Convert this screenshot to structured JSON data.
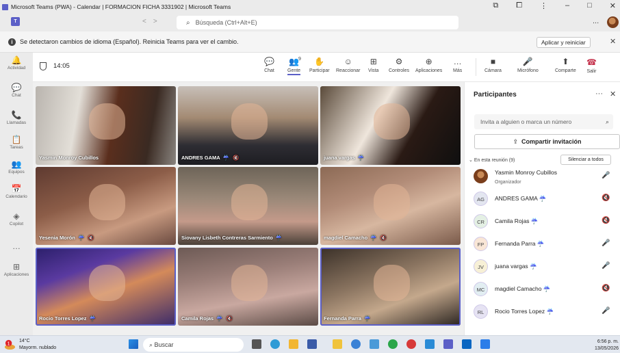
{
  "titlebar": {
    "title": "Microsoft Teams (PWA) - Calendar | FORMACION FICHA 3331902 | Microsoft Teams"
  },
  "searchbar": {
    "placeholder": "Búsqueda (Ctrl+Alt+E)",
    "nav_back": "<",
    "nav_fwd": ">",
    "more": "..."
  },
  "notice": {
    "text": "Se detectaron cambios de idioma (Español). Reinicia Teams para ver el cambio.",
    "restart_button": "Aplicar y reiniciar",
    "close": "✕"
  },
  "rail": [
    {
      "name": "activity",
      "label": "Actividad",
      "icon": "bell-icon",
      "glyph": "🔔"
    },
    {
      "name": "chat",
      "label": "Chat",
      "icon": "chat-icon",
      "glyph": "💬"
    },
    {
      "name": "calls",
      "label": "Llamadas",
      "icon": "phone-icon",
      "glyph": "📞"
    },
    {
      "name": "tasks",
      "label": "Tareas",
      "icon": "clipboard-icon",
      "glyph": "📋"
    },
    {
      "name": "teams",
      "label": "Equipos",
      "icon": "teams-icon",
      "glyph": "👥"
    },
    {
      "name": "calendar",
      "label": "Calendario",
      "icon": "calendar-icon",
      "glyph": "📅"
    },
    {
      "name": "copilot",
      "label": "Copilot",
      "icon": "copilot-icon",
      "glyph": "◈"
    },
    {
      "name": "more",
      "label": "",
      "icon": "more-icon",
      "glyph": "…"
    },
    {
      "name": "apps",
      "label": "Aplicaciones",
      "icon": "apps-icon",
      "glyph": "⊞"
    }
  ],
  "meeting": {
    "timer": "14:05",
    "people_count": "9",
    "tools": [
      {
        "name": "chat",
        "label": "Chat",
        "glyph": "💬"
      },
      {
        "name": "people",
        "label": "Gente",
        "glyph": "👥"
      },
      {
        "name": "raise-hand",
        "label": "Participar",
        "glyph": "✋"
      },
      {
        "name": "react",
        "label": "Reaccionar",
        "glyph": "☺"
      },
      {
        "name": "view",
        "label": "Vista",
        "glyph": "⊞"
      },
      {
        "name": "controls",
        "label": "Controles",
        "glyph": "⚙"
      },
      {
        "name": "apps",
        "label": "Aplicaciones",
        "glyph": "⊕"
      },
      {
        "name": "more",
        "label": "Más",
        "glyph": "…"
      }
    ],
    "media": [
      {
        "name": "camera",
        "label": "Cámara",
        "glyph": "■"
      },
      {
        "name": "mic",
        "label": "Micrófono",
        "glyph": "🎤"
      },
      {
        "name": "share",
        "label": "Comparte",
        "glyph": "⬆"
      }
    ],
    "leave": {
      "label": "Salir",
      "glyph": "☎"
    }
  },
  "tiles": [
    {
      "name": "Yasmin Monroy Cubillos",
      "badge": "",
      "muted": false
    },
    {
      "name": "ANDRES GAMA",
      "badge": "☔",
      "muted": true
    },
    {
      "name": "juana vargas",
      "badge": "☔",
      "muted": false
    },
    {
      "name": "Yesenia Morón",
      "badge": "☔",
      "muted": true
    },
    {
      "name": "Siovany Lisbeth Contreras Sarmiento",
      "badge": "☔",
      "muted": false
    },
    {
      "name": "magdiel Camacho",
      "badge": "☔",
      "muted": true
    },
    {
      "name": "Rocio Torres Lopez",
      "badge": "☔",
      "muted": false
    },
    {
      "name": "Camila Rojas",
      "badge": "☔",
      "muted": true
    },
    {
      "name": "Fernanda Parra",
      "badge": "☔",
      "muted": false
    }
  ],
  "panel": {
    "title": "Participantes",
    "more": "···",
    "close": "✕",
    "invite_placeholder": "Invita a alguien o marca un número",
    "share_label": "Compartir invitación",
    "section_label": "En esta reunión (9)",
    "mute_all": "Silenciar a todos",
    "participants": [
      {
        "initials": "",
        "name": "Yasmin Monroy Cubillos",
        "role": "Organizador",
        "photo": true,
        "muted": false,
        "color": "#7a3e1c"
      },
      {
        "initials": "AG",
        "name": "ANDRES GAMA ☔",
        "role": "",
        "photo": false,
        "muted": true,
        "color": "#e3e6f0"
      },
      {
        "initials": "CR",
        "name": "Camila Rojas ☔",
        "role": "",
        "photo": false,
        "muted": true,
        "color": "#e4f0e4"
      },
      {
        "initials": "FP",
        "name": "Fernanda Parra ☔",
        "role": "",
        "photo": false,
        "muted": false,
        "color": "#f9e6d6"
      },
      {
        "initials": "JV",
        "name": "juana vargas ☔",
        "role": "",
        "photo": false,
        "muted": false,
        "color": "#f7f0d6"
      },
      {
        "initials": "MC",
        "name": "magdiel Camacho ☔",
        "role": "",
        "photo": false,
        "muted": true,
        "color": "#e2eef2"
      },
      {
        "initials": "RL",
        "name": "Rocio Torres Lopez ☔",
        "role": "",
        "photo": false,
        "muted": false,
        "color": "#e6e3f3"
      }
    ]
  },
  "taskbar": {
    "temp": "14°C",
    "weather": "Mayorm. nublado",
    "search": "Buscar",
    "time": "6:56 p. m.",
    "date": "13/05/2026"
  }
}
